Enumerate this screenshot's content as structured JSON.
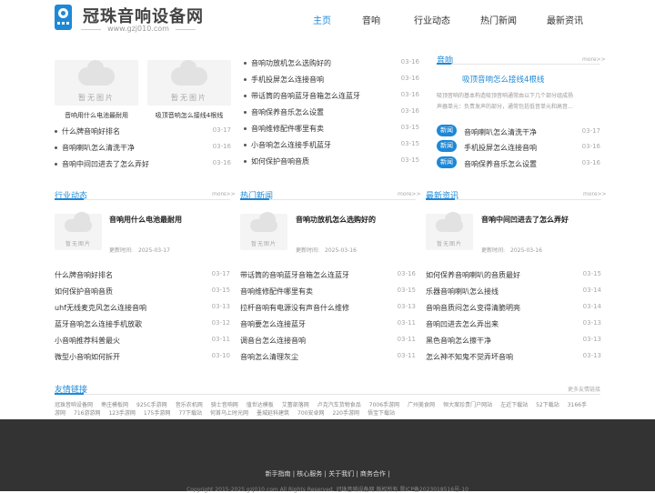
{
  "header": {
    "site_name": "冠珠音响设备网",
    "site_domain": "www.gzj010.com",
    "nav": [
      "主页",
      "音响",
      "行业动态",
      "热门新闻",
      "最新资讯"
    ]
  },
  "placeholder_text": "暂无图片",
  "top_left": {
    "cards": [
      {
        "caption": "音响用什么电池最耐用"
      },
      {
        "caption": "吸顶音响怎么接线4根线"
      }
    ],
    "list": [
      {
        "title": "什么牌音响好排名",
        "date": "03-17"
      },
      {
        "title": "音响喇叭怎么清洗干净",
        "date": "03-16"
      },
      {
        "title": "音响中间凹进去了怎么弄好",
        "date": "03-16"
      }
    ]
  },
  "top_middle": {
    "list": [
      {
        "title": "音响功放机怎么选购好的",
        "date": "03-16"
      },
      {
        "title": "手机投屏怎么连接音响",
        "date": "03-16"
      },
      {
        "title": "带话筒的音响蓝牙音箱怎么连蓝牙",
        "date": "03-16"
      },
      {
        "title": "音响保养音乐怎么设置",
        "date": "03-16"
      },
      {
        "title": "音响维修配件哪里有卖",
        "date": "03-15"
      },
      {
        "title": "小音响怎么连接手机蓝牙",
        "date": "03-15"
      },
      {
        "title": "如何保护音响音质",
        "date": "03-15"
      }
    ]
  },
  "top_right": {
    "title": "音响",
    "more": "more>>",
    "feature_title": "吸顶音响怎么接线4根线",
    "feature_summary_1": "吸顶音响的基本构造吸顶音响通常由以下几个部分组成扬",
    "feature_summary_2": "声器单元：负责发声的部分，通常包括低音单元和高音...",
    "badge": "新闻",
    "list": [
      {
        "title": "音响喇叭怎么清洗干净",
        "date": "03-17"
      },
      {
        "title": "手机投屏怎么连接音响",
        "date": "03-16"
      },
      {
        "title": "音响保养音乐怎么设置",
        "date": "03-16"
      }
    ]
  },
  "columns": [
    {
      "title": "行业动态",
      "more": "more>>",
      "feature": {
        "title": "音响用什么电池最耐用",
        "time": "更新时间:　2025-03-17"
      },
      "list": [
        {
          "title": "什么牌音响好排名",
          "date": "03-17"
        },
        {
          "title": "如何保护音响音质",
          "date": "03-15"
        },
        {
          "title": "uhf无线麦克风怎么连接音响",
          "date": "03-13"
        },
        {
          "title": "蓝牙音响怎么连接手机放歌",
          "date": "03-12"
        },
        {
          "title": "小音响推荐科普最火",
          "date": "03-11"
        },
        {
          "title": "微型小音响如何拆开",
          "date": "03-10"
        }
      ]
    },
    {
      "title": "热门新闻",
      "more": "more>>",
      "feature": {
        "title": "音响功放机怎么选购好的",
        "time": "更新时间:　2025-03-16"
      },
      "list": [
        {
          "title": "带话筒的音响蓝牙音箱怎么连蓝牙",
          "date": "03-16"
        },
        {
          "title": "音响维修配件哪里有卖",
          "date": "03-15"
        },
        {
          "title": "拉杆音响有电源没有声音什么维修",
          "date": "03-13"
        },
        {
          "title": "音响要怎么连接蓝牙",
          "date": "03-11"
        },
        {
          "title": "调音台怎么连接音响",
          "date": "03-11"
        },
        {
          "title": "音响怎么清理灰尘",
          "date": "03-11"
        }
      ]
    },
    {
      "title": "最新资讯",
      "more": "more>>",
      "feature": {
        "title": "音响中间凹进去了怎么弄好",
        "time": "更新时间:　2025-03-16"
      },
      "list": [
        {
          "title": "如何保养音响喇叭的音质最好",
          "date": "03-15"
        },
        {
          "title": "乐器音响喇叭怎么接线",
          "date": "03-14"
        },
        {
          "title": "音响音质闷怎么变得清脆明亮",
          "date": "03-14"
        },
        {
          "title": "音响凹进去怎么弄出来",
          "date": "03-13"
        },
        {
          "title": "黑色音响怎么擦干净",
          "date": "03-13"
        },
        {
          "title": "怎么神不知鬼不觉弄坏音响",
          "date": "03-13"
        }
      ]
    }
  ],
  "friend_links": {
    "title": "友情链接",
    "more": "更多友情链接",
    "row1": [
      "冠珠音响设备网",
      "枣庄模板网",
      "925C手游网",
      "音乐农机网",
      "骑士音响网",
      "值世达模板",
      "艾蕾部落网",
      "卢克汽车货物食品",
      "7006手游网",
      "广州美食网",
      "恒大案珍贵门户网站",
      "左近下载站",
      "52下载站"
    ],
    "row1_tail": "3166手",
    "row2": [
      "游网",
      "716游游网",
      "123手游网",
      "175手游网",
      "77下载站",
      "何首乌上时光网",
      "墨城延科建筑",
      "700安卓网",
      "220手游网",
      "悟宝下载站"
    ]
  },
  "footer": {
    "nav": "新手指南 | 核心服务 | 关于我们 | 商务合作 |",
    "copyright": "Copyright 2015-2025 gzj010.com All Rights Reserved. 冠珠音响设备网 版权所有 晋ICP备2023018516号-10"
  }
}
